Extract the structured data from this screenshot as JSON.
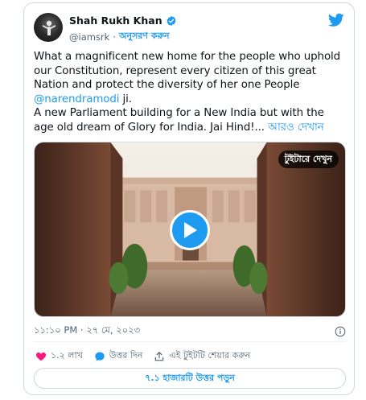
{
  "author": {
    "name": "Shah Rukh Khan",
    "handle": "@iamsrk",
    "separator": "·",
    "follow_label": "অনুসরণ করুন"
  },
  "tweet": {
    "lines": [
      "What a magnificent new home for the people who uphold",
      "our Constitution, represent every citizen of this great",
      "Nation and protect the diversity of her one People"
    ],
    "mention": "@narendramodi",
    "after_mention": " ji.",
    "line5": "A new Parliament building for a New India but with the",
    "line6": "age old dream of Glory for India. Jai Hind!... ",
    "read_more": "আরও দেখান"
  },
  "media": {
    "badge": "টুইটারে দেখুন"
  },
  "meta": {
    "timestamp": "১১:১০ PM · ২৭ মে, ২০২৩"
  },
  "actions": {
    "likes": "১.২ লাখ",
    "reply": "উত্তর দিন",
    "share": "এই টুইটটি শেয়ার করুন"
  },
  "replies_button": "৭.১ হাজারটি উত্তর পড়ুন",
  "colors": {
    "accent": "#1d9bf0",
    "like": "#f91880",
    "text": "#0f1419",
    "muted": "#536471"
  }
}
